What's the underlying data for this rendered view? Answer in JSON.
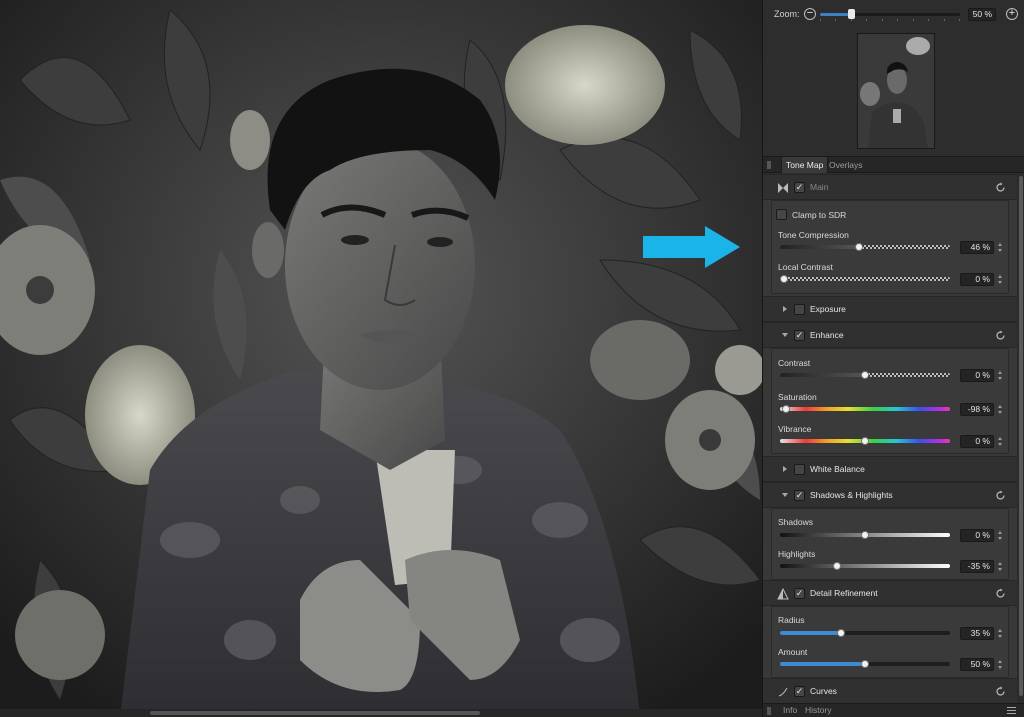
{
  "zoom": {
    "label": "Zoom:",
    "value": "50 %",
    "level": 0.21
  },
  "tabs": [
    {
      "label": "Tone Map",
      "active": true
    },
    {
      "label": "Overlays",
      "active": false
    }
  ],
  "sections": {
    "main": {
      "title": "Main",
      "checked": true
    },
    "clamp": {
      "label": "Clamp to SDR",
      "checked": false
    },
    "tone_compression": {
      "label": "Tone Compression",
      "value": "46 %",
      "level": 0.46
    },
    "local_contrast": {
      "label": "Local Contrast",
      "value": "0 %",
      "level": 0.0
    },
    "exposure": {
      "title": "Exposure",
      "checked": false
    },
    "enhance": {
      "title": "Enhance",
      "checked": true
    },
    "contrast": {
      "label": "Contrast",
      "value": "0 %",
      "level": 0.5
    },
    "saturation": {
      "label": "Saturation",
      "value": "-98 %",
      "level": 0.01
    },
    "vibrance": {
      "label": "Vibrance",
      "value": "0 %",
      "level": 0.5
    },
    "white_balance": {
      "title": "White Balance",
      "checked": false
    },
    "shadows_highlights": {
      "title": "Shadows & Highlights",
      "checked": true
    },
    "shadows": {
      "label": "Shadows",
      "value": "0 %",
      "level": 0.5
    },
    "highlights": {
      "label": "Highlights",
      "value": "-35 %",
      "level": 0.325
    },
    "detail_refinement": {
      "title": "Detail Refinement",
      "checked": true
    },
    "radius": {
      "label": "Radius",
      "value": "35 %",
      "level": 0.35
    },
    "amount": {
      "label": "Amount",
      "value": "50 %",
      "level": 0.5
    },
    "curves": {
      "title": "Curves",
      "checked": true
    }
  },
  "bottom_tabs": [
    "Info",
    "History"
  ],
  "colors": {
    "accent": "#3d8bd0",
    "arrow": "#1bb4e8",
    "panel": "#383838"
  },
  "icons": {
    "zoom_out": "minus-circle-icon",
    "zoom_in": "plus-circle-icon",
    "main": "bowtie-icon",
    "detail": "triangle-icon",
    "reset": "reset-icon",
    "menu": "hamburger-icon"
  }
}
